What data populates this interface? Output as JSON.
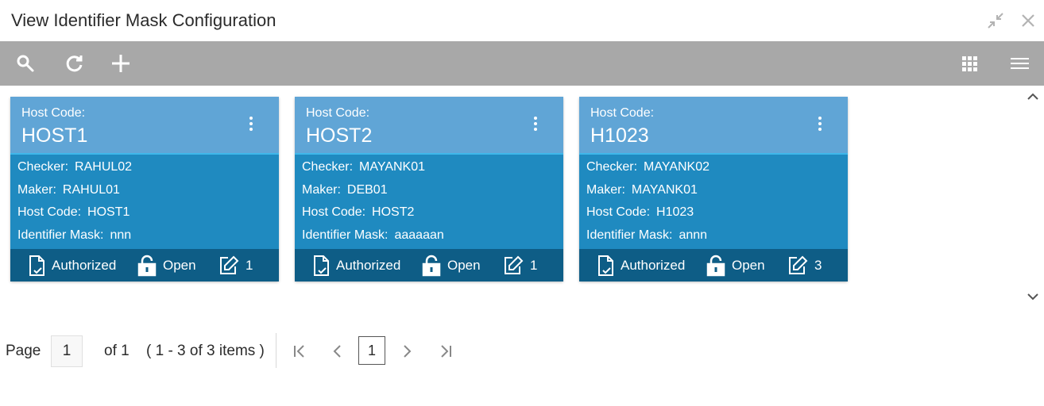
{
  "window": {
    "title": "View Identifier Mask Configuration",
    "minimize_icon": "collapse-arrows-icon",
    "close_icon": "close-icon"
  },
  "toolbar": {
    "left_icons": [
      "search-icon",
      "refresh-icon",
      "add-icon"
    ],
    "right_icons": [
      "grid-view-icon",
      "list-view-icon"
    ]
  },
  "cards": [
    {
      "host_code_label": "Host Code:",
      "host_code": "HOST1",
      "fields": [
        {
          "label": "Checker:",
          "value": "RAHUL02"
        },
        {
          "label": "Maker:",
          "value": "RAHUL01"
        },
        {
          "label": "Host Code:",
          "value": "HOST1"
        },
        {
          "label": "Identifier Mask:",
          "value": "nnn"
        }
      ],
      "status": "Authorized",
      "record_status": "Open",
      "mod_no": "1"
    },
    {
      "host_code_label": "Host Code:",
      "host_code": "HOST2",
      "fields": [
        {
          "label": "Checker:",
          "value": "MAYANK01"
        },
        {
          "label": "Maker:",
          "value": "DEB01"
        },
        {
          "label": "Host Code:",
          "value": "HOST2"
        },
        {
          "label": "Identifier Mask:",
          "value": "aaaaaan"
        }
      ],
      "status": "Authorized",
      "record_status": "Open",
      "mod_no": "1"
    },
    {
      "host_code_label": "Host Code:",
      "host_code": "H1023",
      "fields": [
        {
          "label": "Checker:",
          "value": "MAYANK02"
        },
        {
          "label": "Maker:",
          "value": "MAYANK01"
        },
        {
          "label": "Host Code:",
          "value": "H1023"
        },
        {
          "label": "Identifier Mask:",
          "value": "annn"
        }
      ],
      "status": "Authorized",
      "record_status": "Open",
      "mod_no": "3"
    }
  ],
  "pagination": {
    "page_label": "Page",
    "page_value": "1",
    "of_label": "of 1",
    "range_label": "( 1 - 3 of 3 items )",
    "current_page": "1"
  },
  "colors": {
    "toolbar": "#a8a8a8",
    "card_header": "#60a5d6",
    "card_body": "#1f8ac0",
    "card_footer": "#0e5d86"
  }
}
